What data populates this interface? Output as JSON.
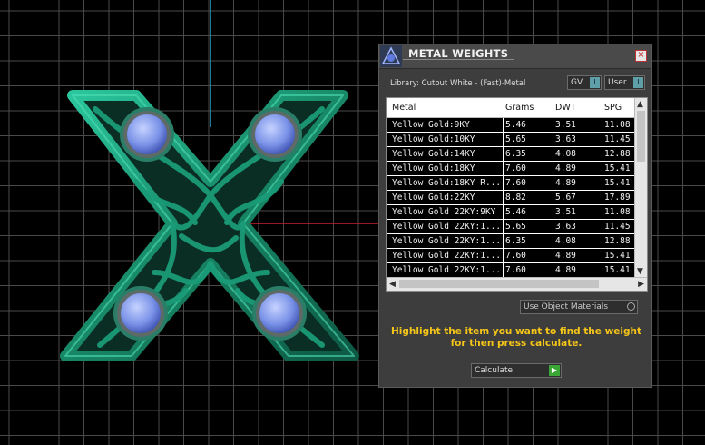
{
  "panel": {
    "title": "METAL WEIGHTS",
    "close_label": "×",
    "library_label": "Library: Cutout White - (Fast)-Metal",
    "toggle_gv": "GV",
    "toggle_user": "User",
    "toggle_knob": "I",
    "columns": [
      "Metal",
      "Grams",
      "DWT",
      "SPG"
    ],
    "rows": [
      [
        "Yellow Gold:9KY",
        "5.46",
        "3.51",
        "11.08"
      ],
      [
        "Yellow Gold:10KY",
        "5.65",
        "3.63",
        "11.45"
      ],
      [
        "Yellow Gold:14KY",
        "6.35",
        "4.08",
        "12.88"
      ],
      [
        "Yellow Gold:18KY",
        "7.60",
        "4.89",
        "15.41"
      ],
      [
        "Yellow Gold:18KY R...",
        "7.60",
        "4.89",
        "15.41"
      ],
      [
        "Yellow Gold:22KY",
        "8.82",
        "5.67",
        "17.89"
      ],
      [
        "Yellow Gold 22KY:9KY",
        "5.46",
        "3.51",
        "11.08"
      ],
      [
        "Yellow Gold 22KY:1...",
        "5.65",
        "3.63",
        "11.45"
      ],
      [
        "Yellow Gold 22KY:1...",
        "6.35",
        "4.08",
        "12.88"
      ],
      [
        "Yellow Gold 22KY:1...",
        "7.60",
        "4.89",
        "15.41"
      ],
      [
        "Yellow Gold 22KY:1...",
        "7.60",
        "4.89",
        "15.41"
      ]
    ],
    "use_object_materials": "Use Object Materials",
    "hint": "Highlight the item you want to find the weight for then press calculate.",
    "calculate_label": "Calculate",
    "calculate_arrow": "▶"
  },
  "viewport": {
    "model_description_icon": "x-pendant-model",
    "colors": {
      "background": "#000000",
      "grid": "#4a4a4a",
      "axis_y": "#1fa3c9",
      "axis_x": "#c8202a",
      "metal": "#1e9a7a",
      "gem": "#7b93e8"
    }
  }
}
